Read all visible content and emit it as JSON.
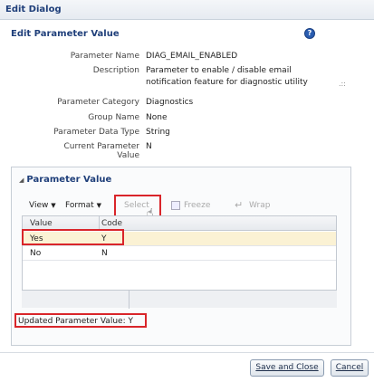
{
  "dialog": {
    "title": "Edit Dialog"
  },
  "section": {
    "title": "Edit Parameter Value",
    "help_icon": "question-mark-icon"
  },
  "properties": [
    {
      "label": "Parameter Name",
      "value": "DIAG_EMAIL_ENABLED"
    },
    {
      "label": "Description",
      "value": "Parameter to enable / disable email notification feature for diagnostic utility"
    },
    {
      "label": "Parameter Category",
      "value": "Diagnostics"
    },
    {
      "label": "Group Name",
      "value": "None"
    },
    {
      "label": "Parameter Data Type",
      "value": "String"
    },
    {
      "label": "Current Parameter Value",
      "value": "N"
    }
  ],
  "panel": {
    "title": "Parameter Value",
    "toolbar": {
      "view": "View",
      "format": "Format",
      "select": "Select",
      "freeze": "Freeze",
      "wrap": "Wrap"
    },
    "table": {
      "columns": [
        "Value",
        "Code"
      ],
      "rows": [
        {
          "value": "Yes",
          "code": "Y",
          "selected": true
        },
        {
          "value": "No",
          "code": "N",
          "selected": false
        }
      ]
    },
    "updated_label": "Updated Parameter Value:",
    "updated_value": "Y"
  },
  "buttons": {
    "save": "Save and Close",
    "cancel": "Cancel"
  },
  "colors": {
    "accent": "#1f3f7a",
    "highlight": "#d9252a",
    "selected_row": "#fbf2d4"
  }
}
